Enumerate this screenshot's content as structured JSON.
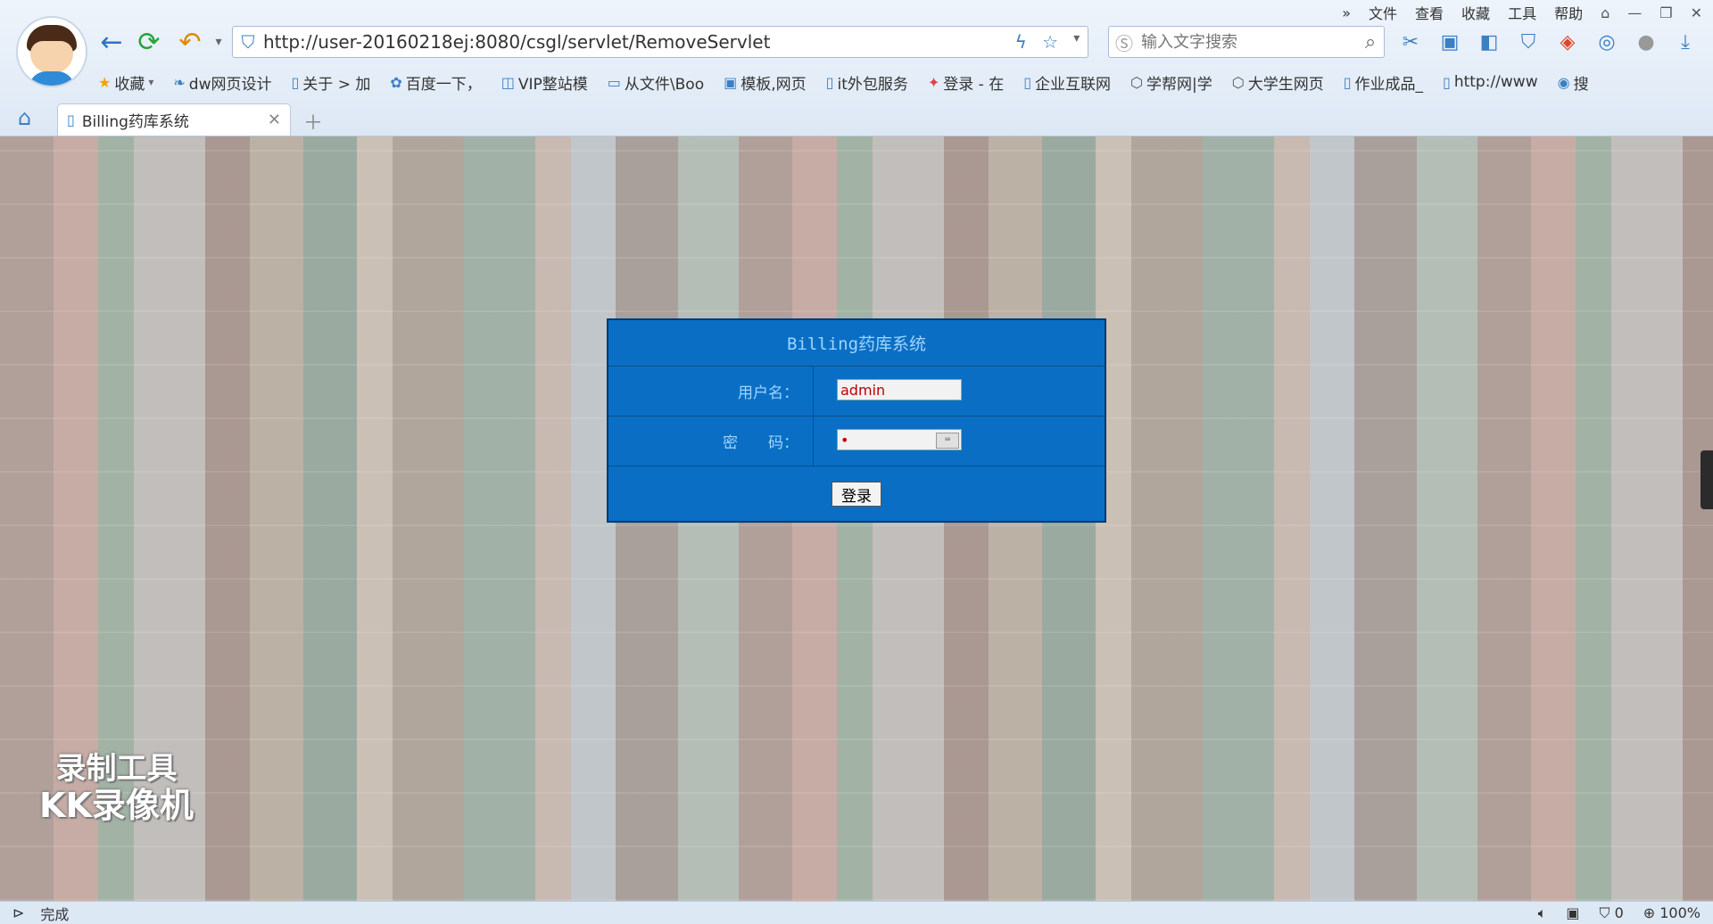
{
  "browser": {
    "menu": [
      "文件",
      "查看",
      "收藏",
      "工具",
      "帮助"
    ],
    "address_url": "http://user-20160218ej:8080/csgl/servlet/RemoveServlet",
    "search_placeholder": "输入文字搜索",
    "bookmarks": [
      {
        "label": "收藏",
        "icon": "star-icon"
      },
      {
        "label": "dw网页设计",
        "icon": "link-icon"
      },
      {
        "label": "关于 > 加",
        "icon": "page-icon"
      },
      {
        "label": "百度一下，",
        "icon": "baidu-icon"
      },
      {
        "label": "VIP整站模",
        "icon": "site-icon"
      },
      {
        "label": "从文件\\Boo",
        "icon": "folder-icon"
      },
      {
        "label": "模板,网页",
        "icon": "page-icon"
      },
      {
        "label": "it外包服务",
        "icon": "page-icon"
      },
      {
        "label": "登录 - 在",
        "icon": "page-icon"
      },
      {
        "label": "企业互联网",
        "icon": "page-icon"
      },
      {
        "label": "学帮网|学",
        "icon": "site-icon"
      },
      {
        "label": "大学生网页",
        "icon": "site-icon"
      },
      {
        "label": "作业成品_",
        "icon": "page-icon"
      },
      {
        "label": "http://www",
        "icon": "page-icon"
      },
      {
        "label": "搜",
        "icon": "search-site-icon"
      }
    ],
    "tab_title": "Billing药库系统",
    "status_left": "完成",
    "status_count": "0",
    "zoom": "100%"
  },
  "login": {
    "title": "Billing药库系统",
    "username_label": "用户名：",
    "username_value": "admin",
    "password_label": "密　　码：",
    "password_value": "•",
    "submit_label": "登录"
  },
  "watermark": {
    "line1": "录制工具",
    "line2": "KK录像机"
  }
}
